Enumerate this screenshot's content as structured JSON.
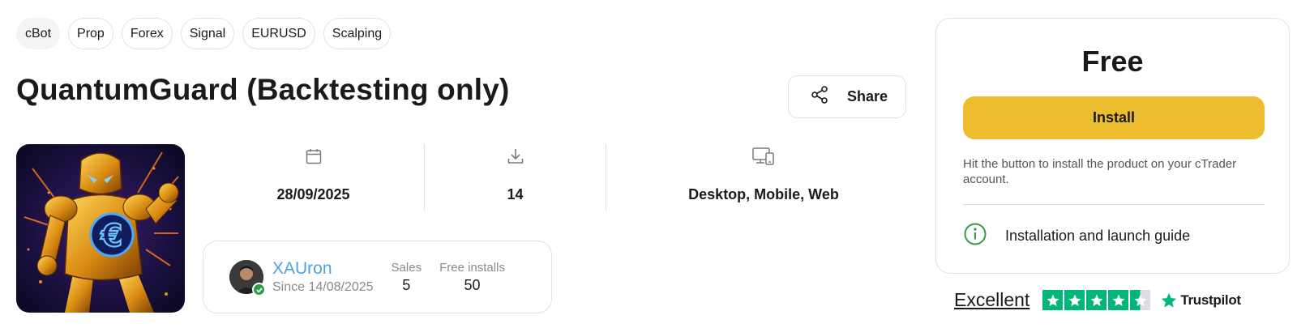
{
  "tags": [
    "cBot",
    "Prop",
    "Forex",
    "Signal",
    "EURUSD",
    "Scalping"
  ],
  "product": {
    "title": "QuantumGuard (Backtesting only)"
  },
  "share": {
    "label": "Share",
    "icon": "share-icon"
  },
  "stats": {
    "date": {
      "icon": "calendar-icon",
      "value": "28/09/2025"
    },
    "downloads": {
      "icon": "download-icon",
      "value": "14"
    },
    "platforms": {
      "icon": "devices-icon",
      "value": "Desktop, Mobile, Web"
    }
  },
  "author": {
    "name": "XAUron",
    "since": "Since 14/08/2025",
    "sales_label": "Sales",
    "sales_value": "5",
    "installs_label": "Free installs",
    "installs_value": "50"
  },
  "sidebar": {
    "price": "Free",
    "install_label": "Install",
    "install_note": "Hit the button to install the product on your cTrader account.",
    "guide_label": "Installation and launch guide"
  },
  "trustpilot": {
    "label": "Excellent",
    "brand": "Trustpilot",
    "rating_stars": 4.5
  },
  "colors": {
    "install_button": "#ebbd2f",
    "author_link": "#4ba3e3",
    "verified_badge": "#2e9c47",
    "trustpilot_green": "#00b67a"
  }
}
